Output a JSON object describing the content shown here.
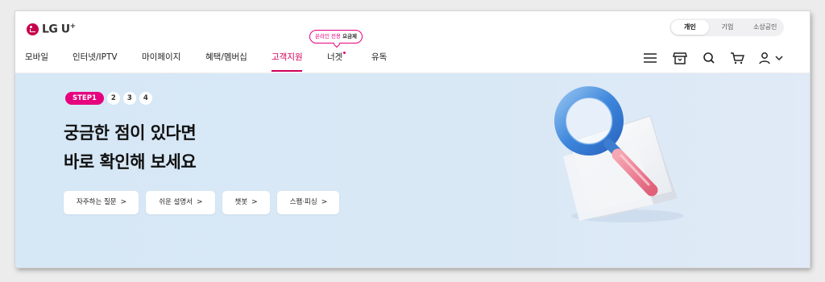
{
  "header": {
    "logo_text": "LG U",
    "logo_plus": "+",
    "segments": [
      "개인",
      "기업",
      "소상공인"
    ]
  },
  "nav": {
    "items": [
      "모바일",
      "인터넷/IPTV",
      "마이페이지",
      "혜택/멤버십",
      "고객지원",
      "너겟",
      "유독"
    ],
    "tooltip_pink": "온라인 전용",
    "tooltip_bold": "요금제"
  },
  "hero": {
    "step_active": "STEP1",
    "steps": [
      "2",
      "3",
      "4"
    ],
    "headline_line1": "궁금한 점이 있다면",
    "headline_line2": "바로 확인해 보세요",
    "buttons": [
      "자주하는 질문",
      "쉬운 설명서",
      "챗봇",
      "스팸·피싱"
    ],
    "chevron": ">"
  },
  "icons": [
    "menu-icon",
    "store-icon",
    "search-icon",
    "cart-icon",
    "user-icon",
    "chevron-down-icon"
  ],
  "colors": {
    "accent": "#e6007e",
    "brand": "#c6004c",
    "hero_bg": "#d9e8f5"
  }
}
